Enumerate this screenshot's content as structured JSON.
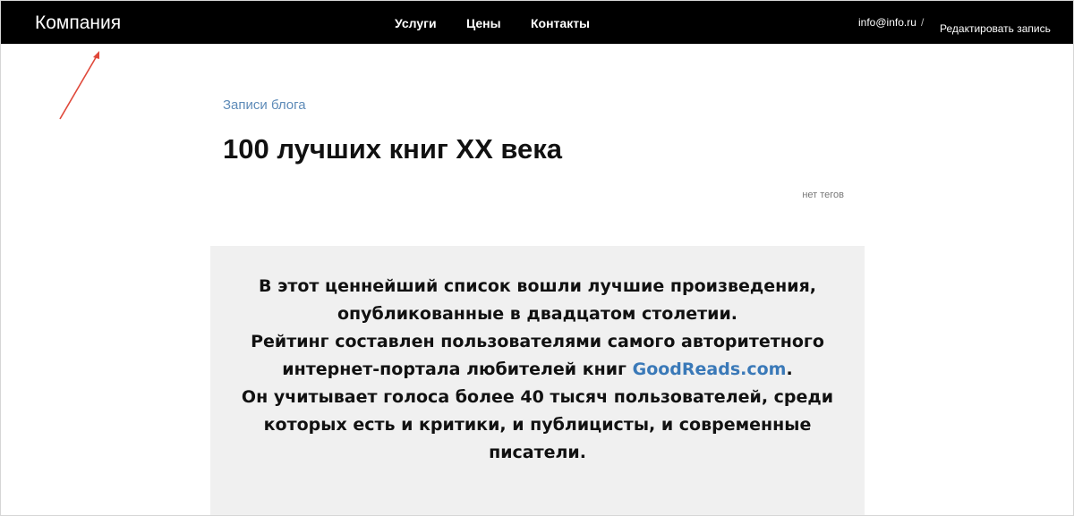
{
  "header": {
    "brand": "Компания",
    "nav": [
      {
        "label": "Услуги"
      },
      {
        "label": "Цены"
      },
      {
        "label": "Контакты"
      }
    ],
    "email": "info@info.ru",
    "email_separator": "/",
    "edit_label": "Редактировать запись"
  },
  "post": {
    "category": "Записи блога",
    "title": "100 лучших книг XX века",
    "tags": "нет тегов"
  },
  "quote": {
    "line1": "В этот ценнейший список вошли лучшие произведения,",
    "line2": "опубликованные в двадцатом столетии.",
    "line3": "Рейтинг составлен пользователями самого авторитетного",
    "line4_prefix": "интернет-портала любителей книг ",
    "line4_link": "GoodReads.com",
    "line4_suffix": ".",
    "line5": "Он учитывает голоса более 40 тысяч пользователей, среди",
    "line6": "которых есть и критики, и публицисты, и современные",
    "line7": "писатели."
  },
  "colors": {
    "header_bg": "#000000",
    "link_blue": "#3a79b8",
    "category_blue": "#5e8bb8",
    "quote_bg": "#f0f0f0",
    "annotation_arrow": "#e0483a"
  }
}
